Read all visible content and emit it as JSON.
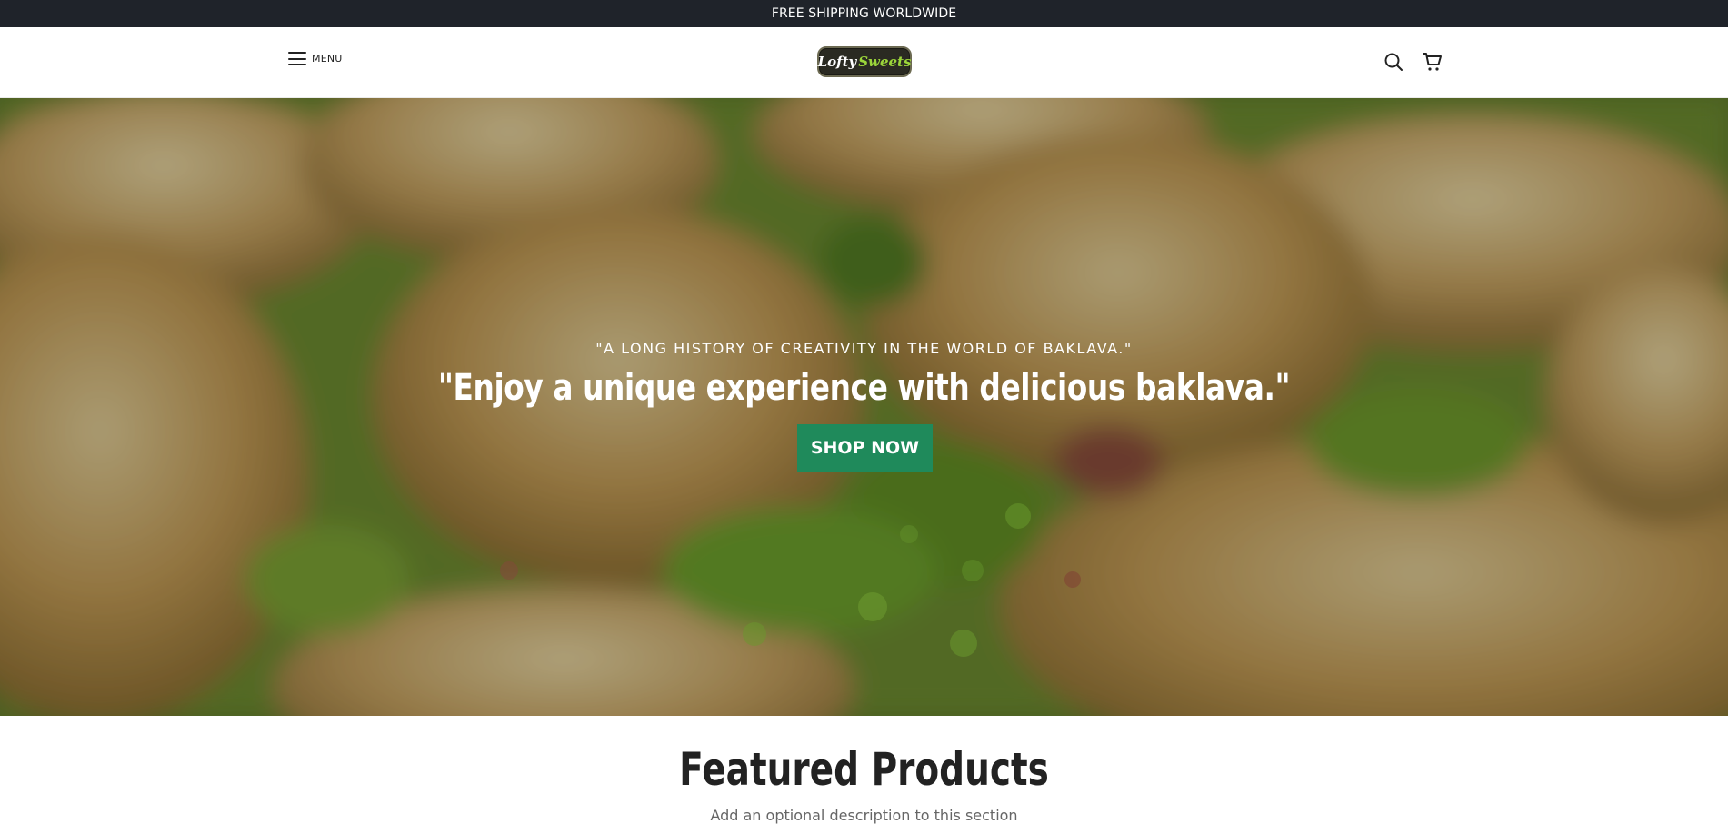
{
  "announcement": {
    "text": "FREE SHIPPING WORLDWIDE"
  },
  "header": {
    "menu_label": "MENU",
    "logo_word1": "Lofty",
    "logo_word2": "Sweets",
    "icons": [
      "search-icon",
      "cart-icon"
    ]
  },
  "hero": {
    "subtitle": "\"A LONG HISTORY OF CREATIVITY IN THE WORLD OF BAKLAVA.\"",
    "title": "\"Enjoy a unique experience with delicious baklava.\"",
    "button_label": "SHOP NOW",
    "button_color": "#1f8a5b"
  },
  "featured": {
    "title": "Featured Products",
    "description": "Add an optional description to this section"
  },
  "colors": {
    "announcement_bg": "#1f232a",
    "accent_green": "#1f8a5b",
    "logo_green": "#9bd53a"
  }
}
